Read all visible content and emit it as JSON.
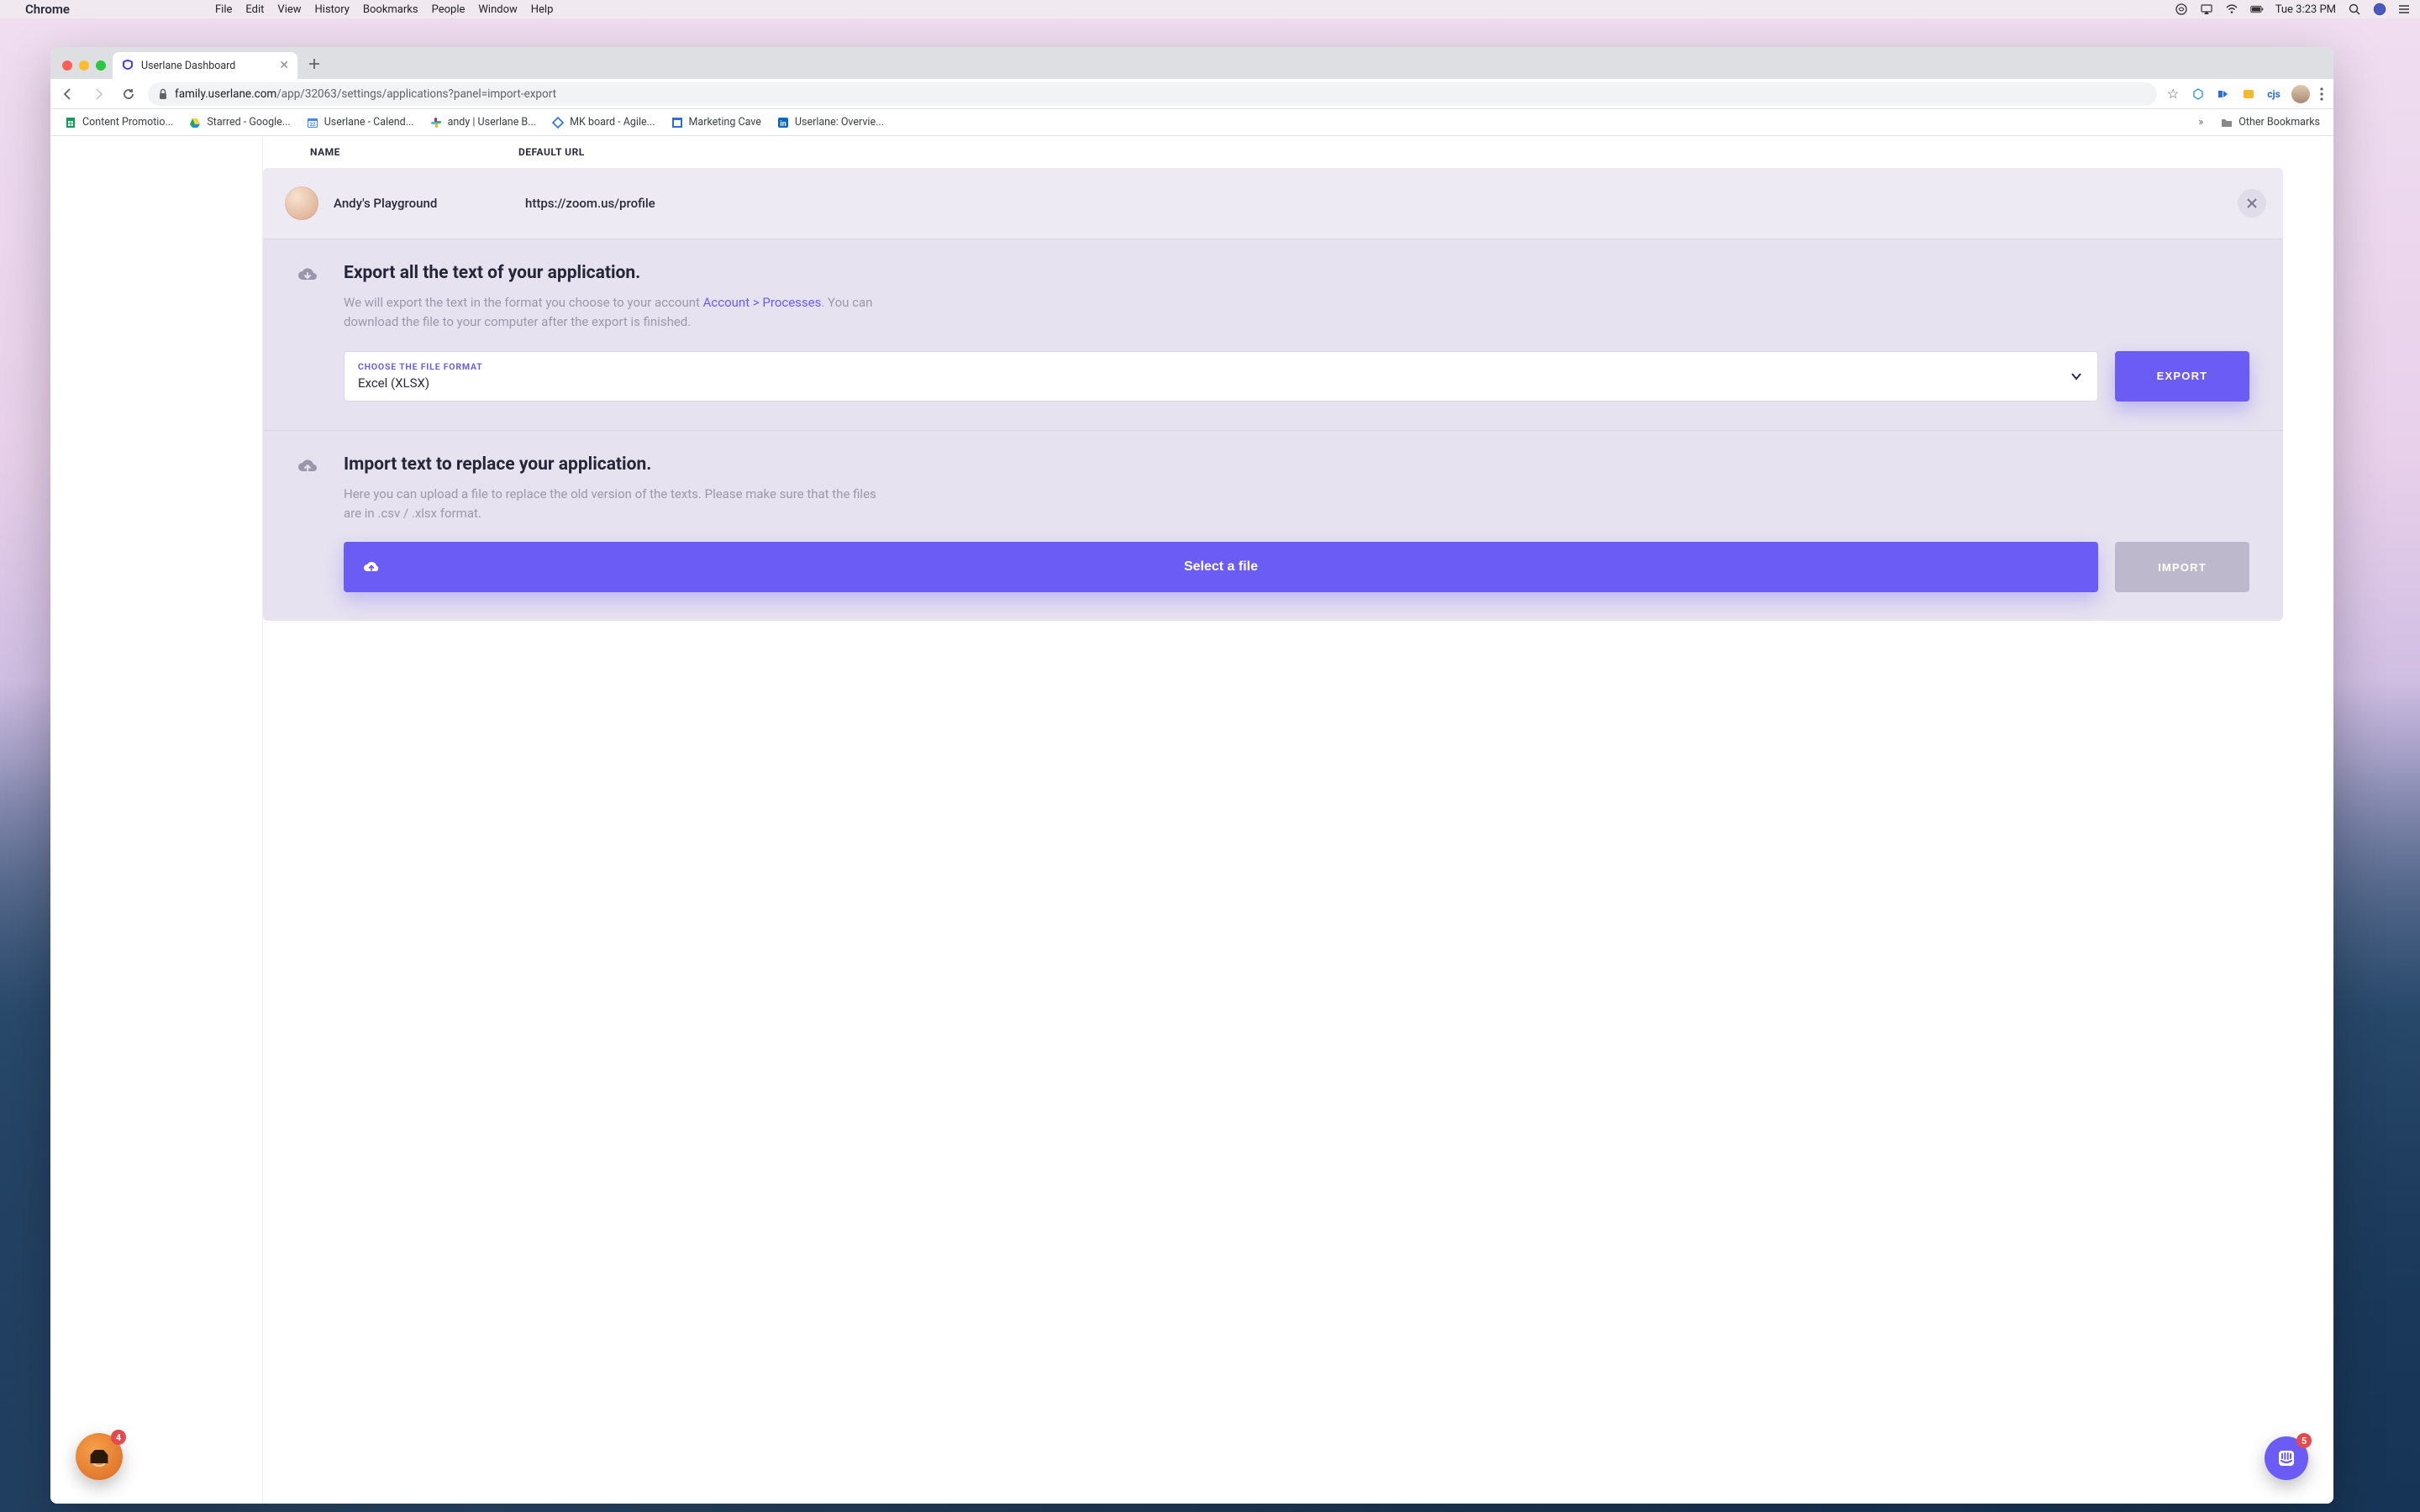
{
  "mac_menubar": {
    "app": "Chrome",
    "menus": [
      "File",
      "Edit",
      "View",
      "History",
      "Bookmarks",
      "People",
      "Window",
      "Help"
    ],
    "clock": "Tue 3:23 PM"
  },
  "browser": {
    "tab_title": "Userlane Dashboard",
    "url_host": "family.userlane.com",
    "url_path": "/app/32063/settings/applications?panel=import-export",
    "ext_cjs": "cjs"
  },
  "bookmarks": [
    {
      "label": "Content Promotio..."
    },
    {
      "label": "Starred - Google..."
    },
    {
      "label": "Userlane - Calend..."
    },
    {
      "label": "andy | Userlane B..."
    },
    {
      "label": "MK board - Agile..."
    },
    {
      "label": "Marketing Cave"
    },
    {
      "label": "Userlane: Overvie..."
    }
  ],
  "bookmarks_other": "Other Bookmarks",
  "page": {
    "headers": {
      "name": "NAME",
      "default_url": "DEFAULT URL"
    },
    "app": {
      "name": "Andy's Playground",
      "url": "https://zoom.us/profile"
    },
    "export": {
      "title": "Export all the text of your application.",
      "desc_before": "We will export the text in the format you choose to your account ",
      "desc_link": "Account > Processes",
      "desc_after": ". You can download the file to your computer after the export is finished.",
      "format_label": "CHOOSE THE FILE FORMAT",
      "format_value": "Excel (XLSX)",
      "button": "EXPORT"
    },
    "import": {
      "title": "Import text to replace your application.",
      "desc": "Here you can upload a file to replace the old version of the texts. Please make sure that the files are in .csv / .xlsx format.",
      "select_button": "Select a file",
      "button": "IMPORT"
    }
  },
  "widgets": {
    "left_badge": "4",
    "right_badge": "5"
  }
}
